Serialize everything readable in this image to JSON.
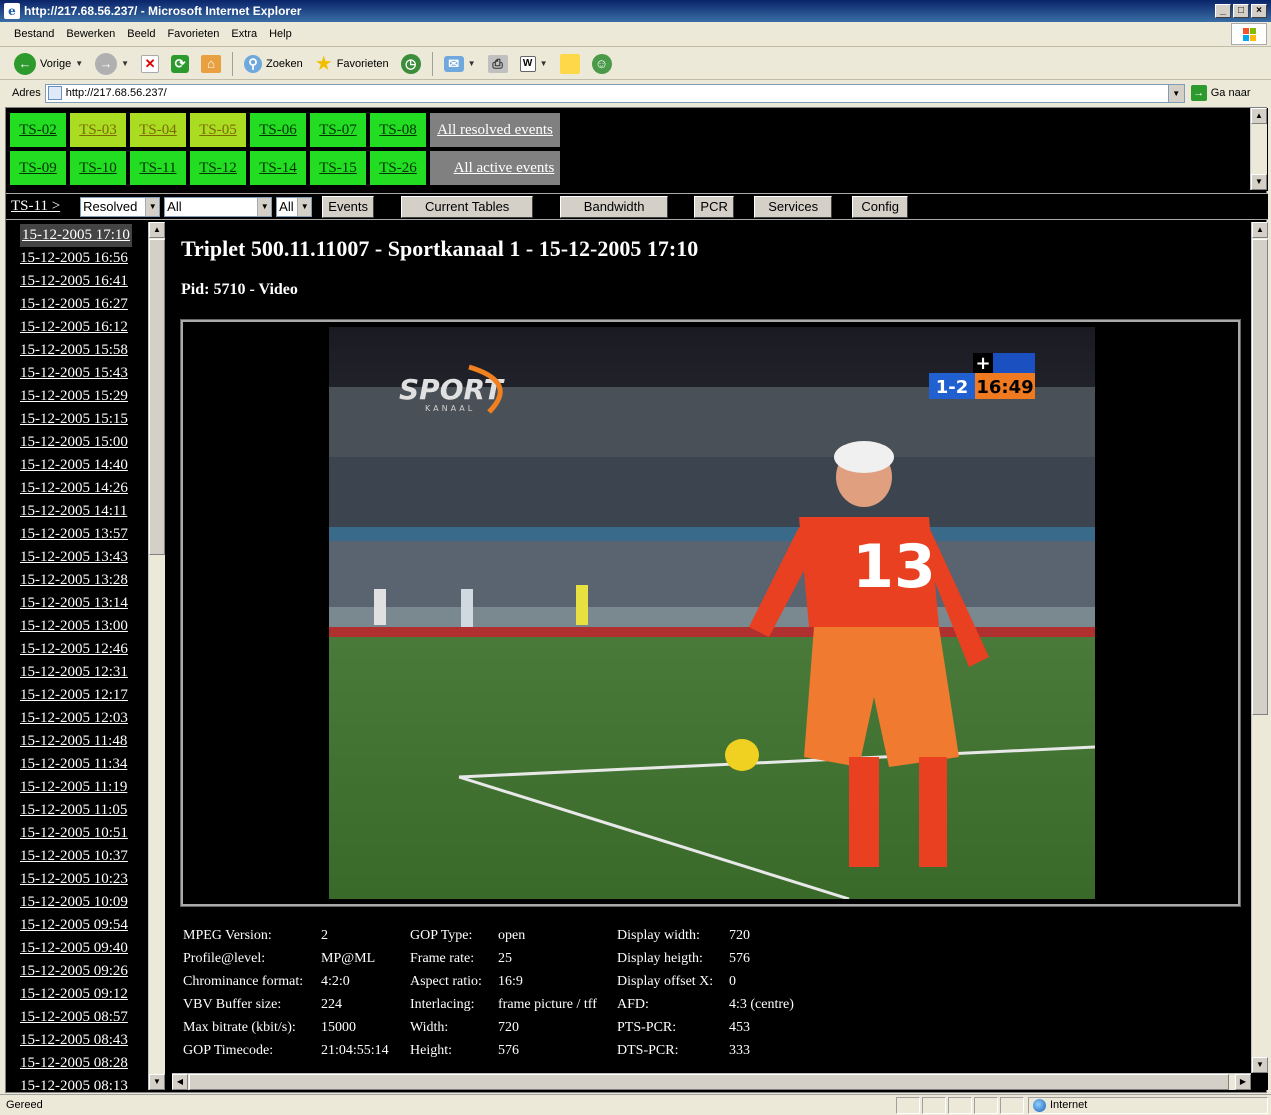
{
  "window": {
    "title": "http://217.68.56.237/ - Microsoft Internet Explorer",
    "icon": "ie-icon"
  },
  "menu": [
    "Bestand",
    "Bewerken",
    "Beeld",
    "Favorieten",
    "Extra",
    "Help"
  ],
  "toolbar": {
    "back_label": "Vorige",
    "search_label": "Zoeken",
    "favorites_label": "Favorieten"
  },
  "address": {
    "label": "Adres",
    "url": "http://217.68.56.237/",
    "go_label": "Ga naar"
  },
  "ts_rows": [
    [
      {
        "label": "TS-02",
        "state": "green"
      },
      {
        "label": "TS-03",
        "state": "yellow"
      },
      {
        "label": "TS-04",
        "state": "yellow"
      },
      {
        "label": "TS-05",
        "state": "yellow"
      },
      {
        "label": "TS-06",
        "state": "green"
      },
      {
        "label": "TS-07",
        "state": "green"
      },
      {
        "label": "TS-08",
        "state": "green"
      }
    ],
    [
      {
        "label": "TS-09",
        "state": "green"
      },
      {
        "label": "TS-10",
        "state": "green"
      },
      {
        "label": "TS-11",
        "state": "green"
      },
      {
        "label": "TS-12",
        "state": "green"
      },
      {
        "label": "TS-14",
        "state": "green"
      },
      {
        "label": "TS-15",
        "state": "green"
      },
      {
        "label": "TS-26",
        "state": "green"
      }
    ]
  ],
  "all_resolved_label": "All resolved events",
  "all_active_label": "All active events",
  "filter": {
    "breadcrumb": "TS-11 >",
    "status_value": "Resolved",
    "type_value": "All",
    "third_value": "All",
    "buttons": [
      "Events",
      "Current Tables",
      "Bandwidth",
      "PCR",
      "Services",
      "Config"
    ]
  },
  "event_list": [
    "15-12-2005 17:10",
    "15-12-2005 16:56",
    "15-12-2005 16:41",
    "15-12-2005 16:27",
    "15-12-2005 16:12",
    "15-12-2005 15:58",
    "15-12-2005 15:43",
    "15-12-2005 15:29",
    "15-12-2005 15:15",
    "15-12-2005 15:00",
    "15-12-2005 14:40",
    "15-12-2005 14:26",
    "15-12-2005 14:11",
    "15-12-2005 13:57",
    "15-12-2005 13:43",
    "15-12-2005 13:28",
    "15-12-2005 13:14",
    "15-12-2005 13:00",
    "15-12-2005 12:46",
    "15-12-2005 12:31",
    "15-12-2005 12:17",
    "15-12-2005 12:03",
    "15-12-2005 11:48",
    "15-12-2005 11:34",
    "15-12-2005 11:19",
    "15-12-2005 11:05",
    "15-12-2005 10:51",
    "15-12-2005 10:37",
    "15-12-2005 10:23",
    "15-12-2005 10:09",
    "15-12-2005 09:54",
    "15-12-2005 09:40",
    "15-12-2005 09:26",
    "15-12-2005 09:12",
    "15-12-2005 08:57",
    "15-12-2005 08:43",
    "15-12-2005 08:28",
    "15-12-2005 08:13"
  ],
  "main": {
    "title": "Triplet 500.11.11007 - Sportkanaal 1 - 15-12-2005 17:10",
    "pid": "Pid: 5710 - Video",
    "video": {
      "logo_text": "SPORT",
      "logo_sub": "KANAAL",
      "score": "1-2",
      "clock": "16:49",
      "shirt_number": "13"
    },
    "info_columns": [
      [
        {
          "label": "MPEG Version:",
          "value": "2"
        },
        {
          "label": "Profile@level:",
          "value": "MP@ML"
        },
        {
          "label": "Chrominance format:",
          "value": "4:2:0"
        },
        {
          "label": "VBV Buffer size:",
          "value": "224"
        },
        {
          "label": "Max bitrate (kbit/s):",
          "value": "15000"
        },
        {
          "label": "GOP Timecode:",
          "value": "21:04:55:14"
        }
      ],
      [
        {
          "label": "GOP Type:",
          "value": "open"
        },
        {
          "label": "Frame rate:",
          "value": "25"
        },
        {
          "label": "Aspect ratio:",
          "value": "16:9"
        },
        {
          "label": "Interlacing:",
          "value": "frame picture / tff"
        },
        {
          "label": "Width:",
          "value": "720"
        },
        {
          "label": "Height:",
          "value": "576"
        }
      ],
      [
        {
          "label": "Display width:",
          "value": "720"
        },
        {
          "label": "Display heigth:",
          "value": "576"
        },
        {
          "label": "Display offset X:",
          "value": "0"
        },
        {
          "label": "AFD:",
          "value": "4:3 (centre)"
        },
        {
          "label": "PTS-PCR:",
          "value": "453"
        },
        {
          "label": "DTS-PCR:",
          "value": "333"
        }
      ]
    ]
  },
  "status": {
    "text": "Gereed",
    "zone": "Internet"
  }
}
